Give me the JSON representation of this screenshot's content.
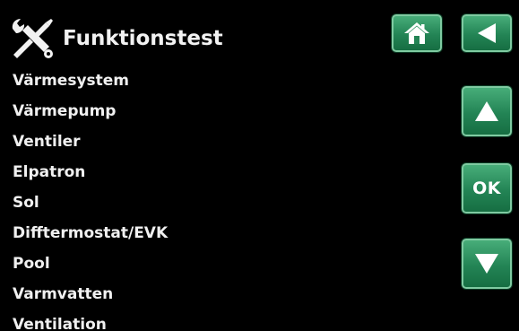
{
  "header": {
    "title": "Funktionstest",
    "icon": "tools-icon"
  },
  "menu": {
    "items": [
      {
        "label": "Värmesystem"
      },
      {
        "label": "Värmepump"
      },
      {
        "label": "Ventiler"
      },
      {
        "label": "Elpatron"
      },
      {
        "label": "Sol"
      },
      {
        "label": "Difftermostat/EVK"
      },
      {
        "label": "Pool"
      },
      {
        "label": "Varmvatten"
      },
      {
        "label": "Ventilation"
      }
    ]
  },
  "buttons": {
    "home_icon": "home-icon",
    "back_icon": "arrow-left-icon",
    "up_icon": "arrow-up-icon",
    "ok_label": "OK",
    "down_icon": "arrow-down-icon"
  },
  "colors": {
    "background": "#000000",
    "button_green": "#238455",
    "text": "#f0f0f0"
  }
}
